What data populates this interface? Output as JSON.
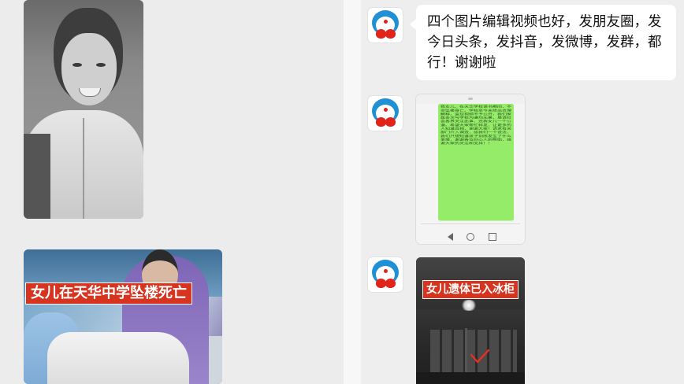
{
  "left_panel": {
    "photo_caption": "女儿在天华中学坠楼死亡"
  },
  "right_panel": {
    "message_1": {
      "text": "四个图片编辑视频也好，发朋友圈，发今日头条，发抖音，发微博，发群，都行！谢谢啦"
    },
    "message_2": {
      "screenshot_text": "我女儿，在天华学校读书期间，不幸坠楼身亡。学校至今未给出合理解释，监控视频不予公开，我们家属多次与学校沟通均无果，恳请社会各界关注此事，还我女儿一个公道。希望大家帮忙转发，让更多的人知道真相，谢谢大家！请求有关部门介入调查，给我们一个说法，我们只想知道孩子到底发生了什么事情，谢谢各位好心人的帮助，感谢大家的关注和支持！！"
    },
    "message_3": {
      "photo_caption": "女儿遗体已入冰柜"
    }
  },
  "icons": {
    "avatar": "doraemon-avatar-icon",
    "nav_back": "triangle-back-icon",
    "nav_home": "circle-home-icon",
    "nav_recent": "square-recent-icon",
    "check_mark": "check-mark-icon"
  },
  "colors": {
    "caption_bg": "#d7341f",
    "sent_bubble": "#95ec69",
    "received_bubble": "#ffffff",
    "avatar_blue": "#1f8fd6"
  }
}
